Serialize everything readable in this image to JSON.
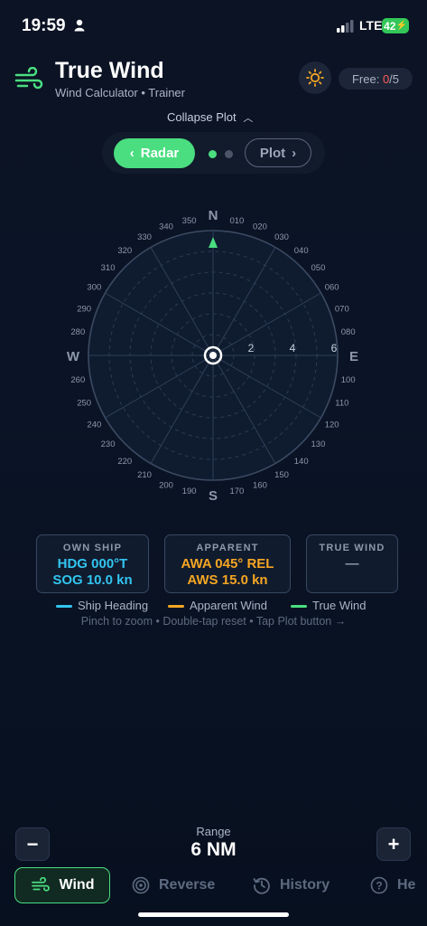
{
  "status": {
    "time": "19:59",
    "network": "LTE",
    "battery": "42"
  },
  "header": {
    "title": "True Wind",
    "subtitle": "Wind Calculator • Trainer",
    "free_label": "Free:",
    "free_used": "0",
    "free_total": "/5"
  },
  "collapse_label": "Collapse Plot",
  "segment": {
    "radar_label": "Radar",
    "plot_label": "Plot"
  },
  "radar": {
    "cardinals": {
      "n": "N",
      "e": "E",
      "s": "S",
      "w": "W"
    },
    "bearing_labels": [
      "010",
      "020",
      "030",
      "040",
      "050",
      "060",
      "070",
      "080",
      "100",
      "110",
      "120",
      "130",
      "140",
      "150",
      "160",
      "170",
      "190",
      "200",
      "210",
      "220",
      "230",
      "240",
      "250",
      "260",
      "280",
      "290",
      "300",
      "310",
      "320",
      "330",
      "340",
      "350"
    ],
    "range_labels": [
      "2",
      "4",
      "6"
    ]
  },
  "boxes": {
    "own_ship": {
      "label": "OWN SHIP",
      "line1": "HDG 000°T",
      "line2": "SOG 10.0 kn",
      "color": "#32c5f0"
    },
    "apparent": {
      "label": "APPARENT",
      "line1": "AWA 045° REL",
      "line2": "AWS 15.0 kn",
      "color": "#f5a623"
    },
    "true_wind": {
      "label": "TRUE WIND",
      "line1": "—"
    }
  },
  "legend": [
    {
      "label": "Ship Heading",
      "color": "#32c5f0"
    },
    {
      "label": "Apparent Wind",
      "color": "#f5a623"
    },
    {
      "label": "True Wind",
      "color": "#4ade80"
    }
  ],
  "hint": "Pinch to zoom • Double-tap reset • Tap Plot button →",
  "range": {
    "label": "Range",
    "value": "6 NM",
    "minus": "−",
    "plus": "+"
  },
  "tabs": [
    {
      "label": "Wind",
      "icon": "wind-icon",
      "active": true
    },
    {
      "label": "Reverse",
      "icon": "target-icon"
    },
    {
      "label": "History",
      "icon": "history-icon"
    },
    {
      "label": "He",
      "icon": "help-icon"
    }
  ]
}
